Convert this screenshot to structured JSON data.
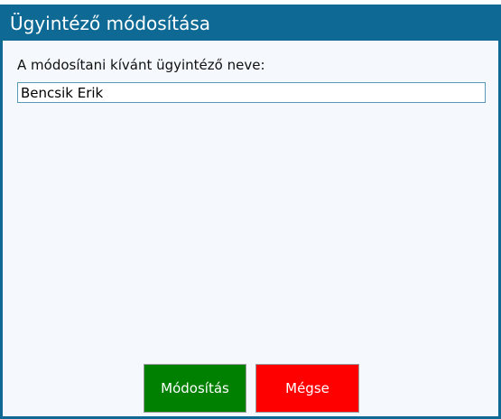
{
  "dialog": {
    "title": "Ügyintéző módosítása",
    "field_label": "A módosítani kívánt ügyintéző neve:",
    "name_value": "Bencsik Erik",
    "buttons": {
      "modify_label": "Módosítás",
      "cancel_label": "Mégse"
    },
    "colors": {
      "title_bar": "#0e6a94",
      "background": "#f5f8fc",
      "modify_button": "#008000",
      "cancel_button": "#ff0000"
    }
  }
}
